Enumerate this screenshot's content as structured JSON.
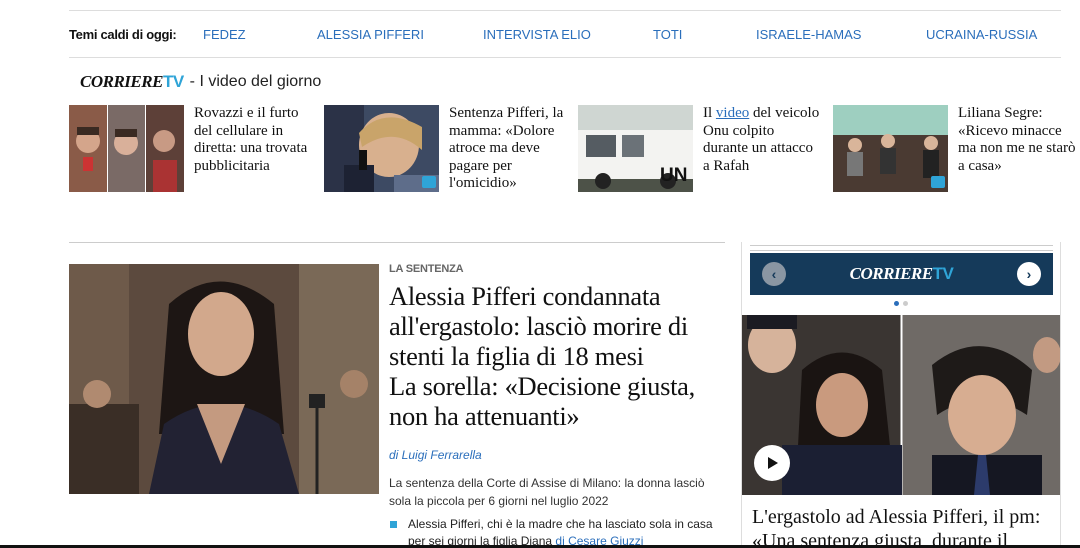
{
  "topics": {
    "label": "Temi caldi di oggi:",
    "items": [
      "FEDEZ",
      "ALESSIA PIFFERI",
      "INTERVISTA ELIO",
      "TOTI",
      "ISRAELE-HAMAS",
      "UCRAINA-RUSSIA"
    ]
  },
  "corriere_tv": {
    "logo_main": "CORRIERE",
    "logo_tv": "TV",
    "subtitle": "- I video del giorno"
  },
  "videos": [
    {
      "text": "Rovazzi e il furto del cellulare in diretta: una trovata pubblicitaria"
    },
    {
      "text": "Sentenza Pifferi, la mamma: «Dolore atroce ma deve pagare per l'omicidio»"
    },
    {
      "pre": "Il ",
      "link": "video",
      "post": " del veicolo Onu colpito durante un attacco a Rafah",
      "thumb_label": "UN"
    },
    {
      "text": "Liliana Segre: «Ricevo minacce ma non me ne starò a casa»"
    }
  ],
  "main_article": {
    "kicker": "LA SENTENZA",
    "headline_1": "Alessia Pifferi condannata all'ergastolo: lasciò morire di stenti la figlia di 18 mesi",
    "headline_2": "La sorella: «Decisione giusta, non ha attenuanti»",
    "byline": "di Luigi Ferrarella",
    "summary": "La sentenza della Corte di Assise di Milano: la donna lasciò sola la piccola per 6 giorni nel luglio 2022",
    "related_text": "Alessia Pifferi, chi è la madre che ha lasciato sola in casa per sei giorni la figlia Diana",
    "related_author": "di Cesare Giuzzi"
  },
  "widget": {
    "logo_main": "CORRIERE",
    "logo_tv": "TV",
    "prev_icon": "‹",
    "next_icon": "›",
    "title": "L'ergastolo ad Alessia Pifferi, il pm: «Una sentenza giusta, durante il"
  },
  "colors": {
    "accent": "#2a6ebb",
    "tv_blue": "#2fa4d7",
    "widget_bg": "#153a5a"
  }
}
